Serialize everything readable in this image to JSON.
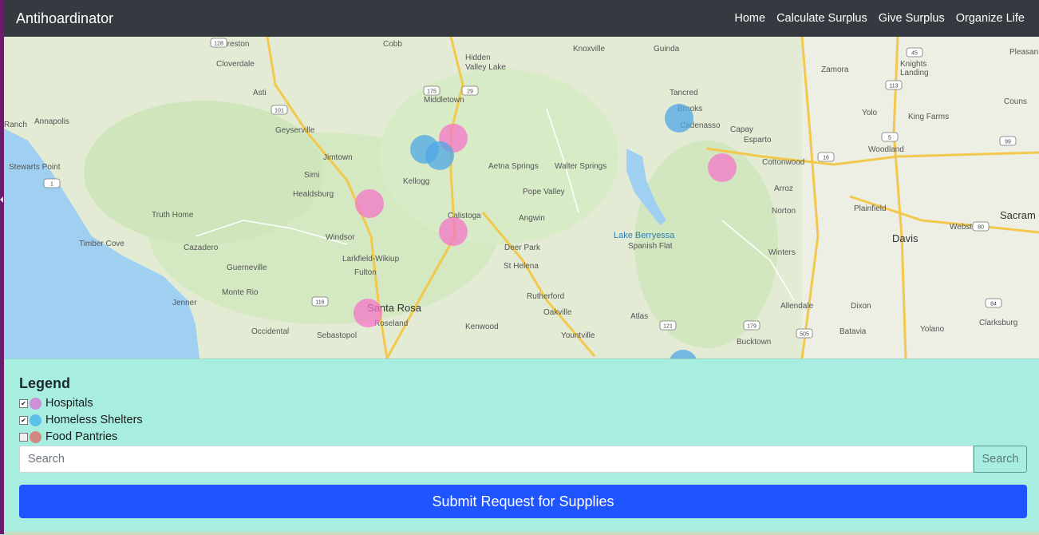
{
  "app": {
    "title": "Antihoardinator"
  },
  "nav": {
    "links": [
      "Home",
      "Calculate Surplus",
      "Give Surplus",
      "Organize Life"
    ]
  },
  "colors": {
    "navbar": "#343a40",
    "panel": "#a7eee0",
    "hospital": "#cf8fd6",
    "homeless_shelter": "#5cc0e8",
    "food_pantry": "#d08a80",
    "hospital_marker": "#f576c8",
    "shelter_marker": "#4fa7e6",
    "submit": "#1e55ff"
  },
  "map": {
    "places": [
      "Preston",
      "Cobb",
      "Hidden",
      "Valley Lake",
      "Knoxville",
      "Guinda",
      "Zamora",
      "Knights",
      "Landing",
      "Pleasan",
      "Cloverdale",
      "Asti",
      "Middletown",
      "Tancred",
      "Brooks",
      "Cadenasso",
      "Capay",
      "Esparto",
      "Yolo",
      "King Farms",
      "Couns",
      "Ranch",
      "Annapolis",
      "Geyserville",
      "Woodland",
      "Stewarts Point",
      "Jimtown",
      "Simi",
      "Aetna Springs",
      "Walter Springs",
      "Cottonwood",
      "Kellogg",
      "Healdsburg",
      "Pope Valley",
      "Arroz",
      "Plainfield",
      "Truth Home",
      "Calistoga",
      "Angwin",
      "Norton",
      "Webster",
      "Sacram",
      "Windsor",
      "Davis",
      "Timber Cove",
      "Cazadero",
      "Deer Park",
      "Spanish Flat",
      "Larkfield-Wikiup",
      "Winters",
      "Guerneville",
      "St Helena",
      "Fulton",
      "Monte Rio",
      "Rutherford",
      "Jenner",
      "Santa Rosa",
      "Oakville",
      "Allendale",
      "Dixon",
      "Roseland",
      "Atlas",
      "Clarksburg",
      "Occidental",
      "Sebastopol",
      "Kenwood",
      "Yountville",
      "Batavia",
      "Yolano",
      "Bucktown"
    ],
    "lake_label": "Lake Berryessa",
    "routes": [
      "128",
      "175",
      "29",
      "101",
      "113",
      "45",
      "16",
      "5",
      "99",
      "1",
      "80",
      "116",
      "121",
      "179",
      "505",
      "84"
    ],
    "markers": [
      {
        "type": "hospital"
      },
      {
        "type": "hospital"
      },
      {
        "type": "hospital"
      },
      {
        "type": "hospital"
      },
      {
        "type": "hospital"
      },
      {
        "type": "homeless_shelter"
      },
      {
        "type": "homeless_shelter"
      },
      {
        "type": "homeless_shelter"
      },
      {
        "type": "homeless_shelter"
      }
    ]
  },
  "legend": {
    "title": "Legend",
    "items": [
      {
        "label": "Hospitals",
        "checked": true,
        "color": "#cf8fd6"
      },
      {
        "label": "Homeless Shelters",
        "checked": true,
        "color": "#5cc0e8"
      },
      {
        "label": "Food Pantries",
        "checked": false,
        "color": "#d08a80"
      }
    ]
  },
  "search": {
    "placeholder": "Search",
    "button_label": "Search"
  },
  "submit": {
    "label": "Submit Request for Supplies"
  }
}
